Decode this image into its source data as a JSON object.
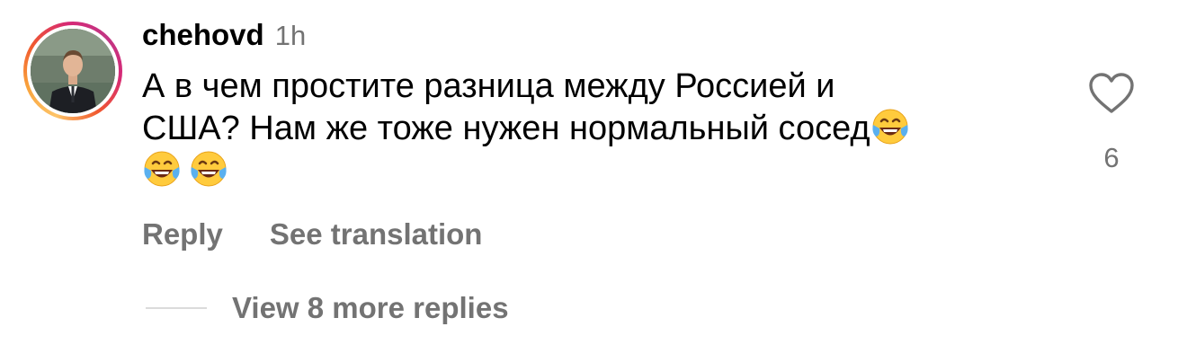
{
  "comment": {
    "username": "chehovd",
    "time": "1h",
    "text_line1": "А в чем простите разница между Россией и",
    "text_line2": "США? Нам же тоже нужен нормальный сосед",
    "emoji_icon": "face-with-tears-of-joy-icon",
    "like_count": "6",
    "like_icon": "heart-outline-icon"
  },
  "actions": {
    "reply_label": "Reply",
    "translate_label": "See translation"
  },
  "replies": {
    "label": "View 8 more replies"
  },
  "colors": {
    "secondary_text": "#737373",
    "divider": "#dbdbdb"
  }
}
